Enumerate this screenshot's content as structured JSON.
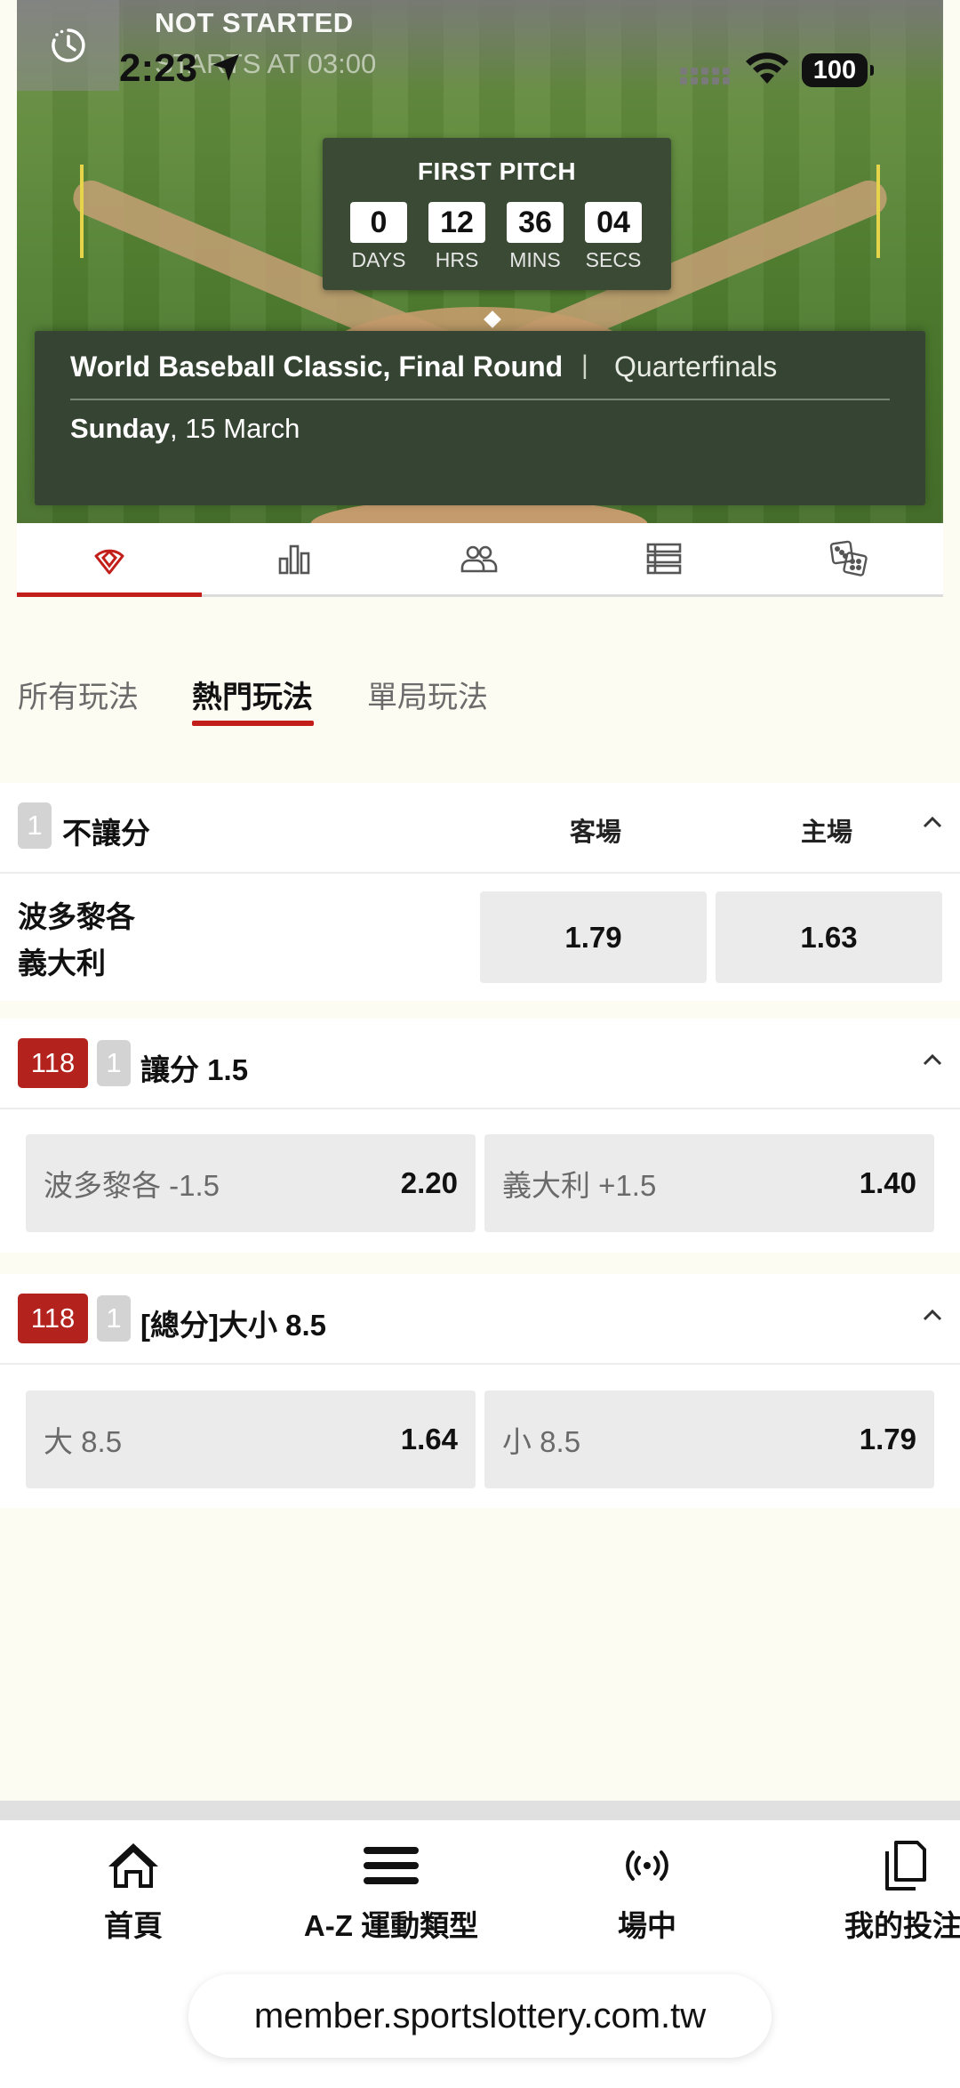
{
  "status_bar": {
    "time": "2:23",
    "battery": "100"
  },
  "hero": {
    "status": "NOT STARTED",
    "starts_at": "STARTS AT 03:00",
    "countdown": {
      "title": "FIRST PITCH",
      "days": "0",
      "days_label": "DAYS",
      "hrs": "12",
      "hrs_label": "HRS",
      "mins": "36",
      "mins_label": "MINS",
      "secs": "04",
      "secs_label": "SECS"
    },
    "tournament": "World Baseball Classic, Final Round",
    "separator": "|",
    "round": "Quarterfinals",
    "date_day": "Sunday",
    "date_rest": ", 15 March"
  },
  "tabs": [
    "markets-icon",
    "stats-icon",
    "lineups-icon",
    "standings-icon",
    "dice-icon"
  ],
  "subtabs": {
    "all": "所有玩法",
    "hot": "熱門玩法",
    "innings": "單局玩法"
  },
  "markets": {
    "moneyline": {
      "index": "1",
      "title": "不讓分",
      "col_away": "客場",
      "col_home": "主場",
      "team_away": "波多黎各",
      "team_home": "義大利",
      "odds_away": "1.79",
      "odds_home": "1.63"
    },
    "handicap": {
      "count": "118",
      "index": "1",
      "title": "讓分 1.5",
      "sel1_label": "波多黎各 -1.5",
      "sel1_odds": "2.20",
      "sel2_label": "義大利 +1.5",
      "sel2_odds": "1.40"
    },
    "total": {
      "count": "118",
      "index": "1",
      "title": "[總分]大小 8.5",
      "sel1_label": "大 8.5",
      "sel1_odds": "1.64",
      "sel2_label": "小 8.5",
      "sel2_odds": "1.79"
    }
  },
  "bottom_nav": {
    "home": "首頁",
    "sports": "A-Z 運動類型",
    "live": "場中",
    "mybets": "我的投注"
  },
  "url": "member.sportslottery.com.tw",
  "colors": {
    "accent": "#c21f1a",
    "badge_red": "#b3221c",
    "card_bg": "#364533"
  }
}
